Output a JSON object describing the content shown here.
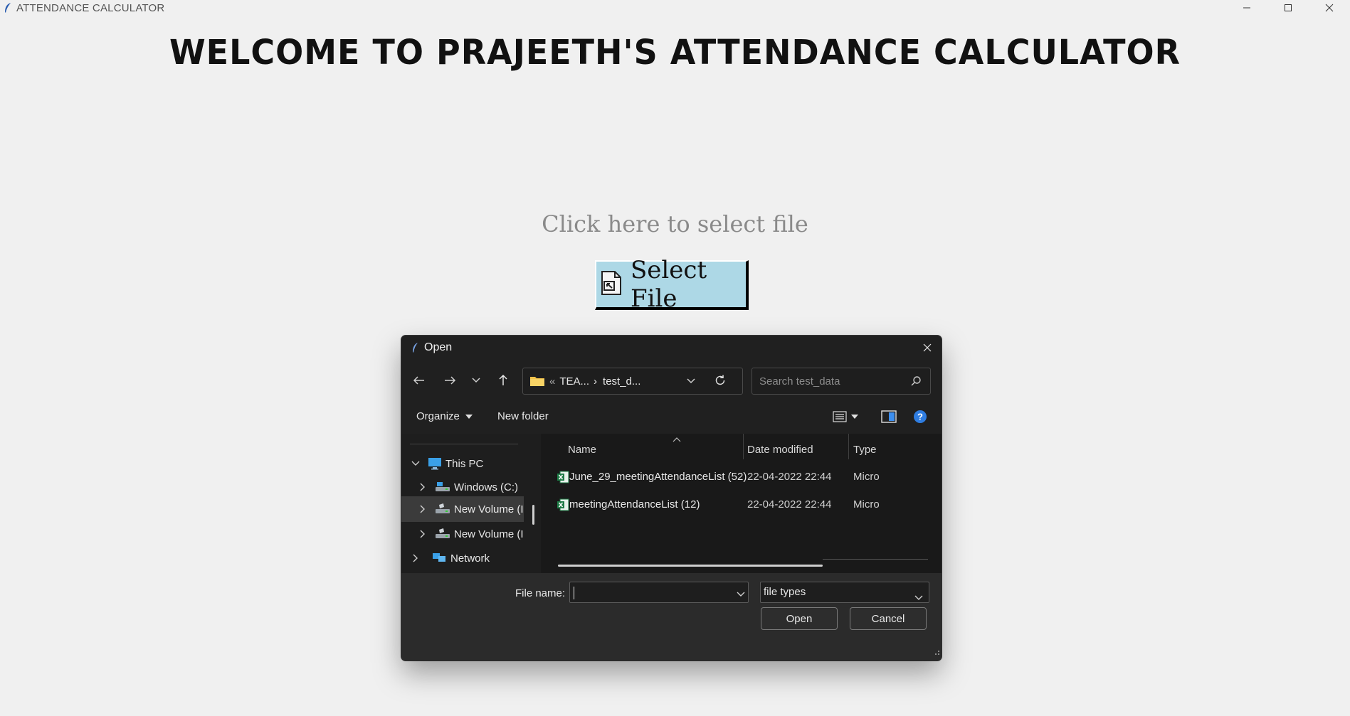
{
  "app": {
    "title": "ATTENDANCE CALCULATOR",
    "window_controls": [
      "minimize-icon",
      "maximize-icon",
      "close-icon"
    ]
  },
  "main": {
    "heading": "WELCOME TO PRAJEETH'S ATTENDANCE CALCULATOR",
    "prompt": "Click here to select file",
    "select_button": {
      "label": "Select File",
      "icon": "file-select-icon",
      "color": "#add8e6"
    }
  },
  "dialog": {
    "title": "Open",
    "address": {
      "overflow": "«",
      "segments": [
        "TEA...",
        "test_d..."
      ],
      "separator": "›"
    },
    "search_placeholder": "Search test_data",
    "toolbar": {
      "organize": "Organize",
      "new_folder": "New folder"
    },
    "tree": [
      {
        "label": "This PC",
        "icon": "monitor-icon",
        "expanded": true
      },
      {
        "label": "Windows (C:)",
        "icon": "drive-icon"
      },
      {
        "label": "New Volume (I",
        "icon": "drive-icon",
        "selected": true
      },
      {
        "label": "New Volume (I",
        "icon": "drive-icon"
      },
      {
        "label": "Network",
        "icon": "network-icon"
      }
    ],
    "columns": {
      "name": "Name",
      "date": "Date modified",
      "type": "Type"
    },
    "files": [
      {
        "name": "June_29_meetingAttendanceList (52)",
        "date": "22-04-2022 22:44",
        "type": "Micro"
      },
      {
        "name": "meetingAttendanceList (12)",
        "date": "22-04-2022 22:44",
        "type": "Micro"
      }
    ],
    "file_name_label": "File name:",
    "file_name_value": "",
    "file_type": "file types",
    "open_button": "Open",
    "cancel_button": "Cancel"
  }
}
